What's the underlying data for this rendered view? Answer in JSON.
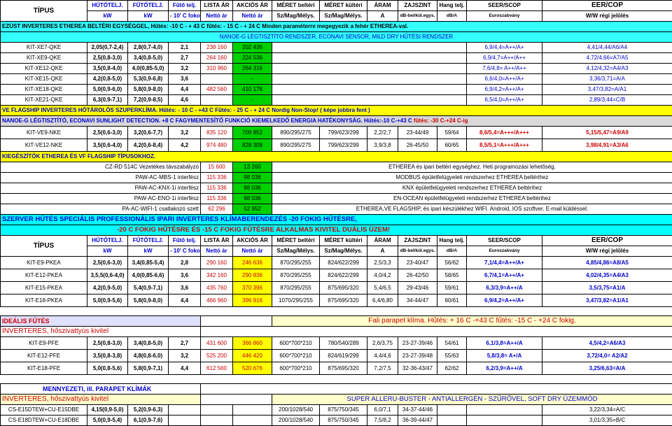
{
  "header1": {
    "tipus": "TÍPUS",
    "cols": [
      "HŰTŐTELJ.",
      "FŰTŐTELJ.",
      "Fűtő telj.",
      "LISTA ÁR",
      "AKCIÓS ÁR",
      "MÉRET beltéri",
      "MÉRET kültéri",
      "ÁRAM",
      "ZAJSZINT",
      "Hang telj.",
      "SEER/SCOP",
      "EER/COP"
    ],
    "units": [
      "kW",
      "kW",
      "- 10' C fokon",
      "Nettó ár",
      "Nettó ár",
      "Sz/Mag/Mélys.",
      "Sz/Mag/Mélys.",
      "A",
      "dB-bel/kül.egys.",
      "dB/A",
      "Euroszabvány",
      "W/W régi jelölés"
    ]
  },
  "banner1": "EZÜST INVERTERES ETHEREA BELTÉRI EGYSÉGGEL, Hűtés: -10 C - + 43 C   fűtés: - 15 C - + 24 C  Minden paraméterre megegyezik a fehér ETHEREA-val.",
  "banner1b": "NANOE-G LÉGTISZTÍTÓ RENDSZER, ECONAVI SENSOR, MILD DRY HŰTÉSI RENDSZER",
  "group1": [
    [
      "KIT-XE7-QKE",
      "2,05(0,7-2,4)",
      "2,8(0,7-4,0)",
      "2,1",
      "238 160",
      "202 436",
      "6,9/4,4=A++/A+",
      "4,41/4,44/A6/A4"
    ],
    [
      "KIT-XE9-QKE",
      "2,5(0,8-3,0)",
      "3,4(0,8-5,0)",
      "2,7",
      "264 160",
      "224 536",
      "6,9/4,7=A++/A++",
      "4,72/4,66=A7/A5"
    ],
    [
      "KIT-XE12-QKE",
      "3,5(0,8-4,0)",
      "4,0(0,85-5,0)",
      "3,2",
      "310 960",
      "264 316",
      "7,6/4,8= A++/A++",
      "4,12/4,32=A4/A3"
    ],
    [
      "KIT-XE15-QKE",
      "4,2(0,8-5,0)",
      "5,3(0,9-6,8)",
      "3,6",
      "",
      "-",
      "6,6/4,0=A++/A+",
      "3,36/3,71=A/A"
    ],
    [
      "KIT-XE18-QKE",
      "5,0(0,9-6,0)",
      "5,8(0,9-8,0)",
      "4,4",
      "482 560",
      "410 176",
      "6,9/4,2=A++/A+",
      "3,47/3,82=A/A1"
    ],
    [
      "KIT-XE21-QKE",
      "6,3(0,9-7,1)",
      "7,2(0,9-8,5)",
      "4,6",
      "",
      "-",
      "6,5/4,0=A++/A+",
      "2,89/3,44=C/B"
    ]
  ],
  "banner2": "VE FLAGSHIP INVERTERES HŐTÁROLÓS SZUPERKLÍMA. Hűtés: - 10 C - +43 C  Fűtés: - 25 C - + 24 C Nordig Non-Stop!  ( képe jobbra fent )",
  "banner2b": "NANOE-G LÉGTISZTÍTÓ, ECONAVI SUNLIGHT DETECTION. +8 C FAGYMENTESÍTŐ FUNKCIÓ KIEMELKEDŐ ENERGIA HATÉKONYSÁG. Hűtés:-10 C-+43 C ",
  "banner2b_red": "fűtés: -30 C-+24 C-ig",
  "group2": [
    [
      "KIT-VE9-NKE",
      "2,5(0,6-3,0)",
      "3,2(0,6-7,7)",
      "3,2",
      "835 120",
      "709 852",
      "890/295/275",
      "799/623/299",
      "2,2/2,7",
      "23-44/49",
      "59/64",
      "8,6/5,4=A+++/A+++",
      "5,15/5,47=A9/A9"
    ],
    [
      "KIT-VE12-NKE",
      "3,5(0,6-4,0)",
      "4,2(0,6-8,4)",
      "4,2",
      "974 480",
      "828 308",
      "890/295/275",
      "799/623/299",
      "3,9/3,8",
      "26-45/50",
      "60/65",
      "8,5/5,1=A+++/A+++",
      "3,98/4,91=A3/A6"
    ]
  ],
  "banner3": "KIEGÉSZÍTŐK ETHEREA ÉS VF FLAGSHIP TÍPUSOKHOZ.",
  "accessories": [
    [
      "CZ-RD 514C Vezetékes távszabályzó",
      "15 600",
      "13 260",
      "ETHEREA és ipari beltéri egységhez. Heti programozási lehetőség."
    ],
    [
      "PAW-AC-MBS-1 interfész",
      "115 336",
      "98 036",
      "MODBUS épületfelügyeleti rendszerhez ETHEREA beltérihez"
    ],
    [
      "PAW-AC-KNX-1i interfész",
      "115 336",
      "98 036",
      "KNX épületfelügyeleti rendszerhez ETHEREA beltérihez"
    ],
    [
      "PAW-AC-ENO-1i interfész",
      "115 336",
      "98 036",
      "EN-OCEAN épületfelügyeleti rendszerhez ETHEREA beltérihez"
    ],
    [
      "PA-AC-WIFI-1 csatlakozó szett",
      "62 296",
      "52 952",
      "ETHEREA,VE FLAGSHIP, és ipari készülékhez WIFI. Android, IOS szoftver. E-mail küldéssel."
    ]
  ],
  "banner4": "SZERVER HŰTÉS SPECIÁLIS PROFESSIONÁLIS IPARI  INVERTERES KLÍMABERENDEZÉS -20 FOKIG HŰTÉSRE,",
  "banner4b": "-20 C FOKIG HŰTÉSRE ÉS -15 C FOKIG  FŰTÉSRE ALKALMAS KIVITEL   DUÁLIS ÜZEM!",
  "group3": [
    [
      "KIT-E9-PKEA",
      "2,5(0,6-3,0)",
      "3,4(0,85-5,4)",
      "2,8",
      "290 160",
      "246 636",
      "870/295/255",
      "824/622/299",
      "2,5/3,3",
      "23-40/47",
      "56/62",
      "7,1/4,4=A++/A+",
      "4,85/4,86=A8/A5"
    ],
    [
      "KIT-E12-PKEA",
      "3,5,5(0,6-4,0)",
      "4,0(0,85-6,6)",
      "3,6",
      "342 160",
      "290 836",
      "870/295/255",
      "824/622/299",
      "4,0/4,2",
      "26-42/50",
      "58/65",
      "6,7/4,1=A++/A+",
      "4,02/4,35=A4/A3"
    ],
    [
      "KIT-E15-PKEA",
      "4,2(0,9-5,0)",
      "5,4(0,9-7,1)",
      "3,6",
      "435 760",
      "370 396",
      "870/295/255",
      "875/695/320",
      "5,4/6,5",
      "29-43/46",
      "59/61",
      "6,3/3,9=A++/A",
      "3,5/3,75=A1/A"
    ],
    [
      "KIT-E18-PKEA",
      "5,0(0,9-5,6)",
      "5,8(0,9-8,0)",
      "4,4",
      "466 960",
      "396 916",
      "1070/295/255",
      "875/695/320",
      "6,4/6,80",
      "34-44/47",
      "60/61",
      "6,9/4,2=A++/A+",
      "3,47/3,82=A1/A1"
    ]
  ],
  "ideal": {
    "title": "IDEÁLIS FŰTÉS",
    "sub": "INVERTERES, hőszivattyús kivitel",
    "right": "Fali parapet klíma. Hűtés: + 16 C -+43 C fűtés: -15 C - +24 C fokig."
  },
  "group4": [
    [
      "KIT-E9-PFE",
      "2,5(0,8-3,0)",
      "3,4(0,8-5,0)",
      "2,7",
      "431 600",
      "366 860",
      "600*700*210",
      "780/540/289",
      "2,6/3,75",
      "23-27-39/46",
      "54/61",
      "6,1/3,8=A++/A",
      "4,5/4,2=A6/A3"
    ],
    [
      "KIT-E12-PFE",
      "3,5(0,8-3,8)",
      "4,8(0,8-6,0)",
      "3,2",
      "525 200",
      "446 420",
      "600*700*210",
      "824/619/299",
      "4,4/4,6",
      "23-27-39/48",
      "55/63",
      "5,8/3,8= A+/A",
      "3,72/4,0= A2/A2"
    ],
    [
      "KIT-E18-PFE",
      "5,0(0,8-5,6)",
      "5,8(0,9-7,1)",
      "4,4",
      "612 560",
      "520 676",
      "600*700*210",
      "875/695/320",
      "7,2/7,5",
      "32-36-43/47",
      "62/62",
      "6,2/3,9=A++/A",
      "3,25/6,63=A/A"
    ]
  ],
  "mennyezeti": {
    "title": "MENNYEZETI, ill. PARAPET KLÍMÁK",
    "sub": "INVERTERES, hőszivattyús kivitel",
    "right": "SUPER ALLERU-BUSTER - ANTIALLERGÉN - SZŰRŐVEL, SOFT DRY ÜZEMMÓD"
  },
  "group5": [
    [
      "CS-E15DTEW+CU-E15DBE",
      "4,15(0,9-5,0)",
      "5,2(0,9-6,3)",
      "",
      "",
      "",
      "200/1028/540",
      "875/750/345",
      "6,0/7,1",
      "34-37-44/46",
      "",
      "",
      "3,22/3,34=A/C"
    ],
    [
      "CS-E18DTEW+CU-E18DBE",
      "5,0(0,9-5,4)",
      "6,1(0,9-7,6)",
      "",
      "",
      "",
      "200/1028/540",
      "875/750/345",
      "7,5/8,2",
      "36-39-44/47",
      "",
      "",
      "3,01/3,35=B/C"
    ]
  ]
}
